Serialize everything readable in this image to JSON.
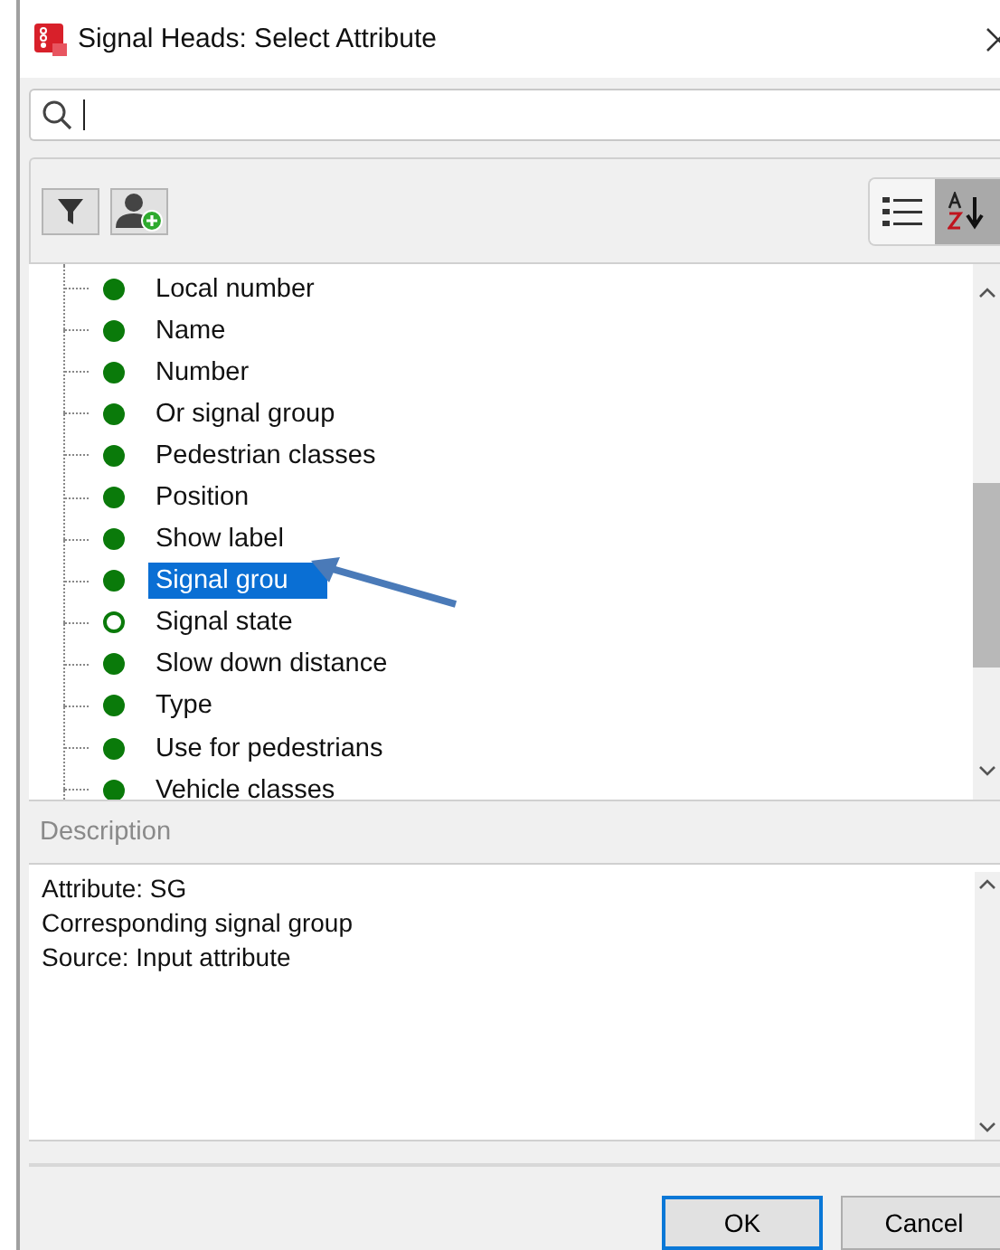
{
  "window": {
    "title": "Signal Heads: Select Attribute"
  },
  "toolbar": {
    "view_buttons": [
      {
        "kind": "list",
        "selected": false
      },
      {
        "kind": "sort",
        "selected": true
      }
    ]
  },
  "tree": {
    "items": [
      {
        "label": "Local number",
        "filled": true,
        "selected": false
      },
      {
        "label": "Name",
        "filled": true,
        "selected": false
      },
      {
        "label": "Number",
        "filled": true,
        "selected": false
      },
      {
        "label": "Or signal group",
        "filled": true,
        "selected": false
      },
      {
        "label": "Pedestrian classes",
        "filled": true,
        "selected": false
      },
      {
        "label": "Position",
        "filled": true,
        "selected": false
      },
      {
        "label": "Show label",
        "filled": true,
        "selected": false
      },
      {
        "label": "Signal grou",
        "filled": true,
        "selected": true
      },
      {
        "label": "Signal state",
        "filled": false,
        "selected": false
      },
      {
        "label": "Slow down distance",
        "filled": true,
        "selected": false
      },
      {
        "label": "Type",
        "filled": true,
        "selected": false
      },
      {
        "label": "Use for pedestrians",
        "filled": true,
        "selected": false
      },
      {
        "label": "Vehicle classes",
        "filled": true,
        "selected": false
      }
    ]
  },
  "description": {
    "heading": "Description",
    "lines": [
      "Attribute: SG",
      "Corresponding signal group",
      "Source: Input attribute"
    ]
  },
  "buttons": [
    {
      "label": "OK",
      "default": true
    },
    {
      "label": "Cancel",
      "default": false
    }
  ]
}
